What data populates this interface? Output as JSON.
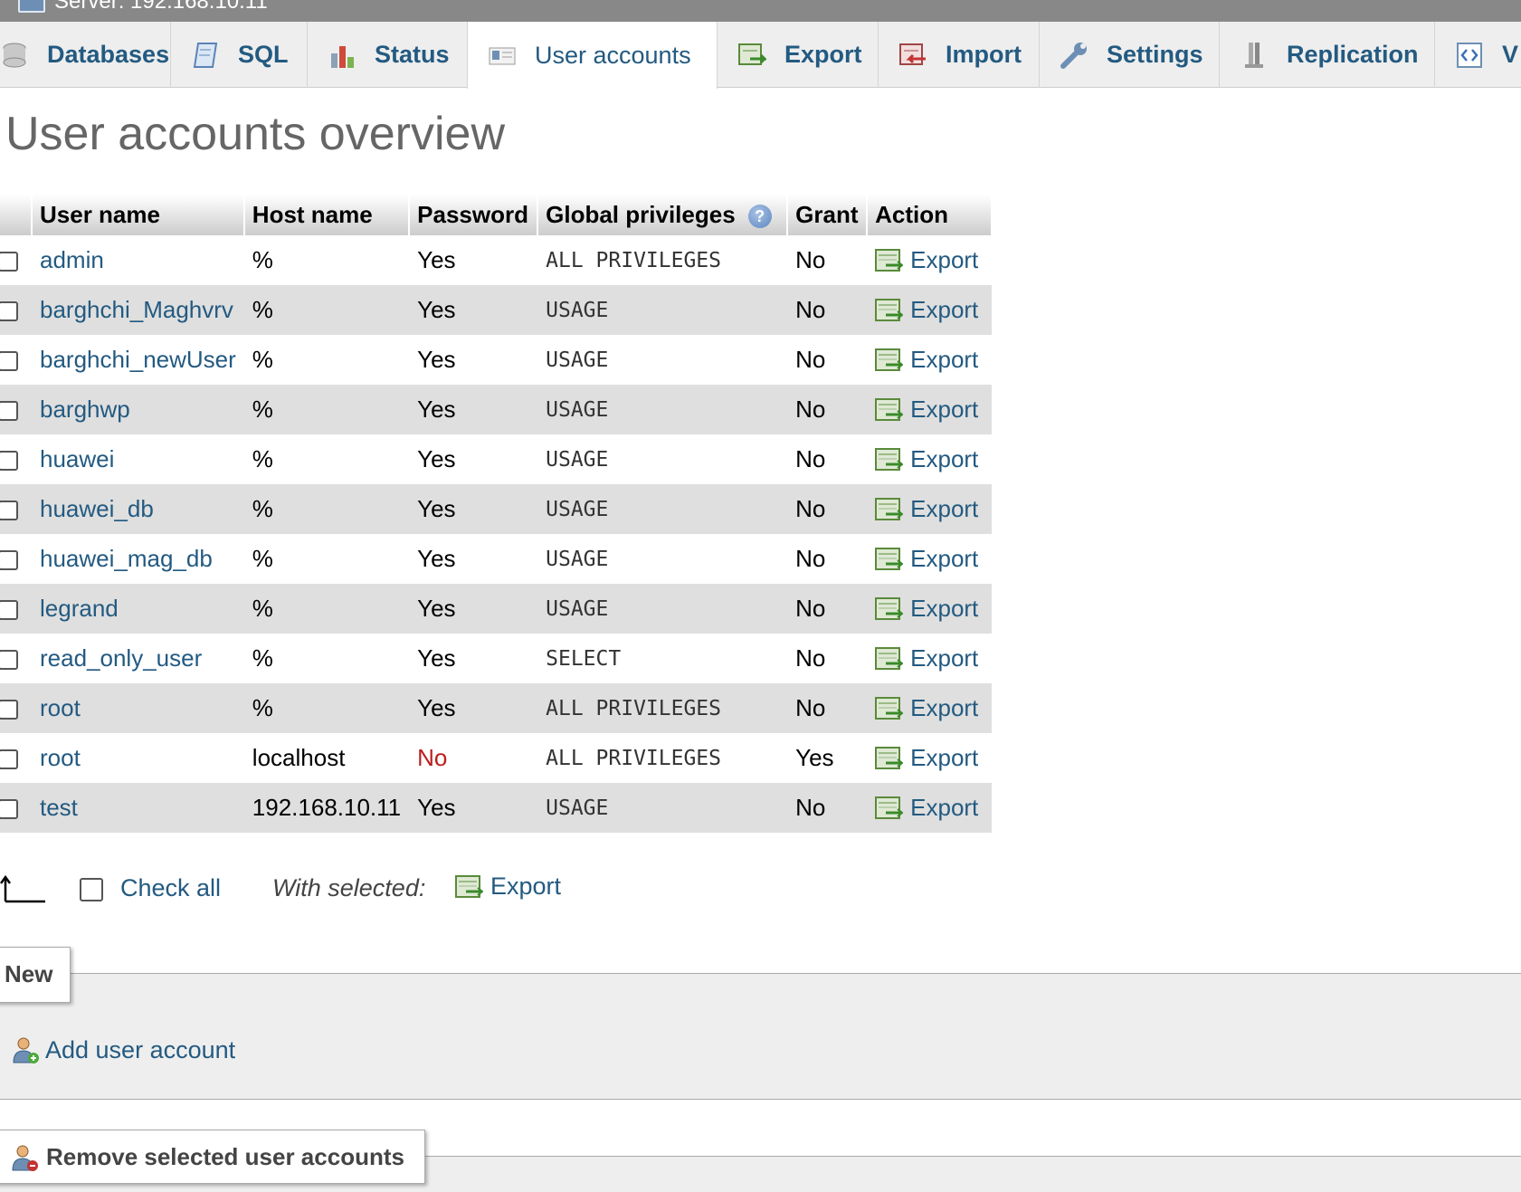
{
  "window": {
    "title": "Server: 192.168.10.11"
  },
  "tabs": [
    {
      "label": "Databases",
      "icon": "database-icon"
    },
    {
      "label": "SQL",
      "icon": "sql-icon"
    },
    {
      "label": "Status",
      "icon": "status-chart-icon"
    },
    {
      "label": "User accounts",
      "icon": "user-accounts-icon",
      "active": true
    },
    {
      "label": "Export",
      "icon": "export-icon"
    },
    {
      "label": "Import",
      "icon": "import-icon"
    },
    {
      "label": "Settings",
      "icon": "wrench-icon"
    },
    {
      "label": "Replication",
      "icon": "replication-icon"
    },
    {
      "label": "V",
      "icon": "variables-icon"
    }
  ],
  "page_title": "User accounts overview",
  "table": {
    "headers": {
      "user": "User name",
      "host": "Host name",
      "password": "Password",
      "privileges": "Global privileges",
      "grant": "Grant",
      "action": "Action"
    },
    "rows": [
      {
        "user": "admin",
        "host": "%",
        "password": "Yes",
        "privileges": "ALL PRIVILEGES",
        "grant": "No",
        "action": "Export"
      },
      {
        "user": "barghchi_Maghvrv",
        "host": "%",
        "password": "Yes",
        "privileges": "USAGE",
        "grant": "No",
        "action": "Export"
      },
      {
        "user": "barghchi_newUser",
        "host": "%",
        "password": "Yes",
        "privileges": "USAGE",
        "grant": "No",
        "action": "Export"
      },
      {
        "user": "barghwp",
        "host": "%",
        "password": "Yes",
        "privileges": "USAGE",
        "grant": "No",
        "action": "Export"
      },
      {
        "user": "huawei",
        "host": "%",
        "password": "Yes",
        "privileges": "USAGE",
        "grant": "No",
        "action": "Export"
      },
      {
        "user": "huawei_db",
        "host": "%",
        "password": "Yes",
        "privileges": "USAGE",
        "grant": "No",
        "action": "Export"
      },
      {
        "user": "huawei_mag_db",
        "host": "%",
        "password": "Yes",
        "privileges": "USAGE",
        "grant": "No",
        "action": "Export"
      },
      {
        "user": "legrand",
        "host": "%",
        "password": "Yes",
        "privileges": "USAGE",
        "grant": "No",
        "action": "Export"
      },
      {
        "user": "read_only_user",
        "host": "%",
        "password": "Yes",
        "privileges": "SELECT",
        "grant": "No",
        "action": "Export"
      },
      {
        "user": "root",
        "host": "%",
        "password": "Yes",
        "privileges": "ALL PRIVILEGES",
        "grant": "No",
        "action": "Export"
      },
      {
        "user": "root",
        "host": "localhost",
        "password": "No",
        "privileges": "ALL PRIVILEGES",
        "grant": "Yes",
        "action": "Export"
      },
      {
        "user": "test",
        "host": "192.168.10.11",
        "password": "Yes",
        "privileges": "USAGE",
        "grant": "No",
        "action": "Export"
      }
    ]
  },
  "bulk": {
    "check_all": "Check all",
    "with_selected": "With selected:",
    "export": "Export"
  },
  "new_section": {
    "legend": "New",
    "add_user": "Add user account"
  },
  "remove_section": {
    "legend": "Remove selected user accounts"
  },
  "colors": {
    "link": "#235a81",
    "no_password": "#bb1d1d",
    "row_alt": "#dfdfdf"
  }
}
